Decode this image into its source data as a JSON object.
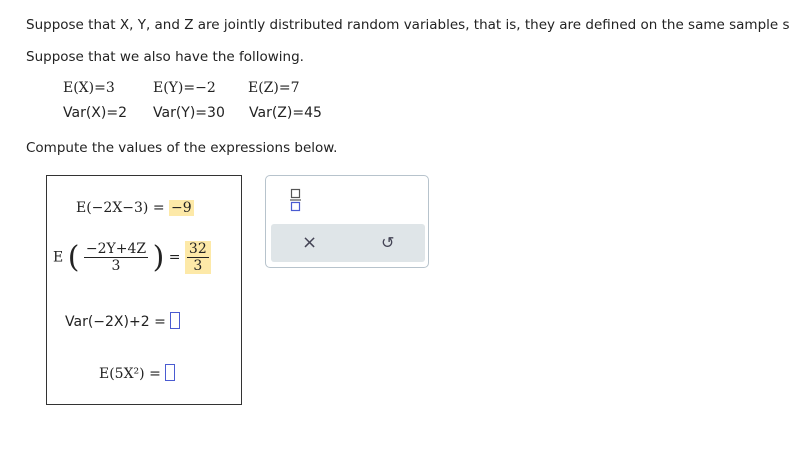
{
  "intro": {
    "line1": "Suppose that X, Y, and Z are jointly distributed random variables, that is, they are defined on the same sample space.",
    "line2": "Suppose that we also have the following.",
    "line3": "Compute the values of the expressions below."
  },
  "given": {
    "ex": "E(X)=3",
    "ey": "E(Y)=−2",
    "ez": "E(Z)=7",
    "varx": "Var(X)=2",
    "vary": "Var(Y)=30",
    "varz": "Var(Z)=45"
  },
  "problems": {
    "p1_expr": "E(−2X−3) =",
    "p1_answer": "−9",
    "p2_prefix": "E",
    "p2_num": "−2Y+4Z",
    "p2_den": "3",
    "p2_eq": "=",
    "p2_ans_num": "32",
    "p2_ans_den": "3",
    "p3_expr": "Var(−2X)+2 =",
    "p4_expr": "E(5X²) ="
  },
  "toolbar": {
    "fraction_icon": "fraction-icon",
    "clear_icon": "close-icon",
    "reset_icon": "undo-icon",
    "clear_glyph": "×",
    "reset_glyph": "↺"
  },
  "colors": {
    "highlight": "#fde9a8",
    "blank_border": "#4a5bd1",
    "toolbar_bg": "#dfe5e8"
  }
}
